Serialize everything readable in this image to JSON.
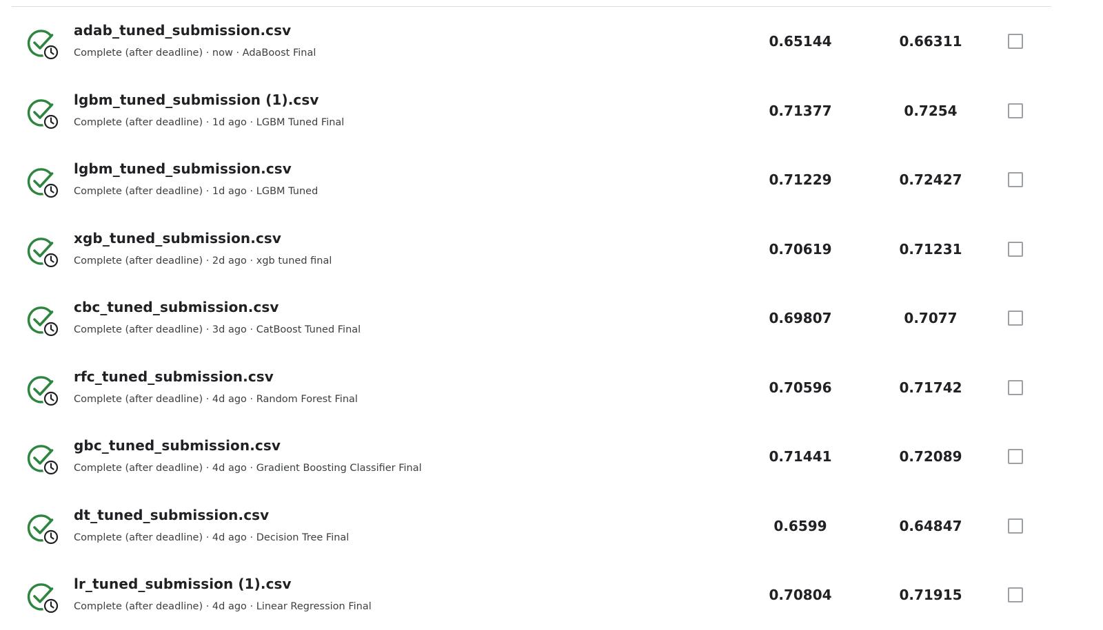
{
  "colors": {
    "check_green": "#2e8540",
    "clock_dark": "#202124",
    "checkbox_border": "#9aa0a6",
    "divider": "#dadce0"
  },
  "icons": {
    "status": "check-with-clock-icon",
    "select": "checkbox-icon"
  },
  "submissions": [
    {
      "file_name": "adab_tuned_submission.csv",
      "meta": "Complete (after deadline) · now · AdaBoost Final",
      "private_score": "0.65144",
      "public_score": "0.66311",
      "selected": false
    },
    {
      "file_name": "lgbm_tuned_submission (1).csv",
      "meta": "Complete (after deadline) · 1d ago · LGBM Tuned Final",
      "private_score": "0.71377",
      "public_score": "0.7254",
      "selected": false
    },
    {
      "file_name": "lgbm_tuned_submission.csv",
      "meta": "Complete (after deadline) · 1d ago · LGBM Tuned",
      "private_score": "0.71229",
      "public_score": "0.72427",
      "selected": false
    },
    {
      "file_name": "xgb_tuned_submission.csv",
      "meta": "Complete (after deadline) · 2d ago · xgb tuned final",
      "private_score": "0.70619",
      "public_score": "0.71231",
      "selected": false
    },
    {
      "file_name": "cbc_tuned_submission.csv",
      "meta": "Complete (after deadline) · 3d ago · CatBoost Tuned Final",
      "private_score": "0.69807",
      "public_score": "0.7077",
      "selected": false
    },
    {
      "file_name": "rfc_tuned_submission.csv",
      "meta": "Complete (after deadline) · 4d ago · Random Forest Final",
      "private_score": "0.70596",
      "public_score": "0.71742",
      "selected": false
    },
    {
      "file_name": "gbc_tuned_submission.csv",
      "meta": "Complete (after deadline) · 4d ago · Gradient Boosting Classifier Final",
      "private_score": "0.71441",
      "public_score": "0.72089",
      "selected": false
    },
    {
      "file_name": "dt_tuned_submission.csv",
      "meta": "Complete (after deadline) · 4d ago · Decision Tree Final",
      "private_score": "0.6599",
      "public_score": "0.64847",
      "selected": false
    },
    {
      "file_name": "lr_tuned_submission (1).csv",
      "meta": "Complete (after deadline) · 4d ago · Linear Regression Final",
      "private_score": "0.70804",
      "public_score": "0.71915",
      "selected": false
    }
  ]
}
